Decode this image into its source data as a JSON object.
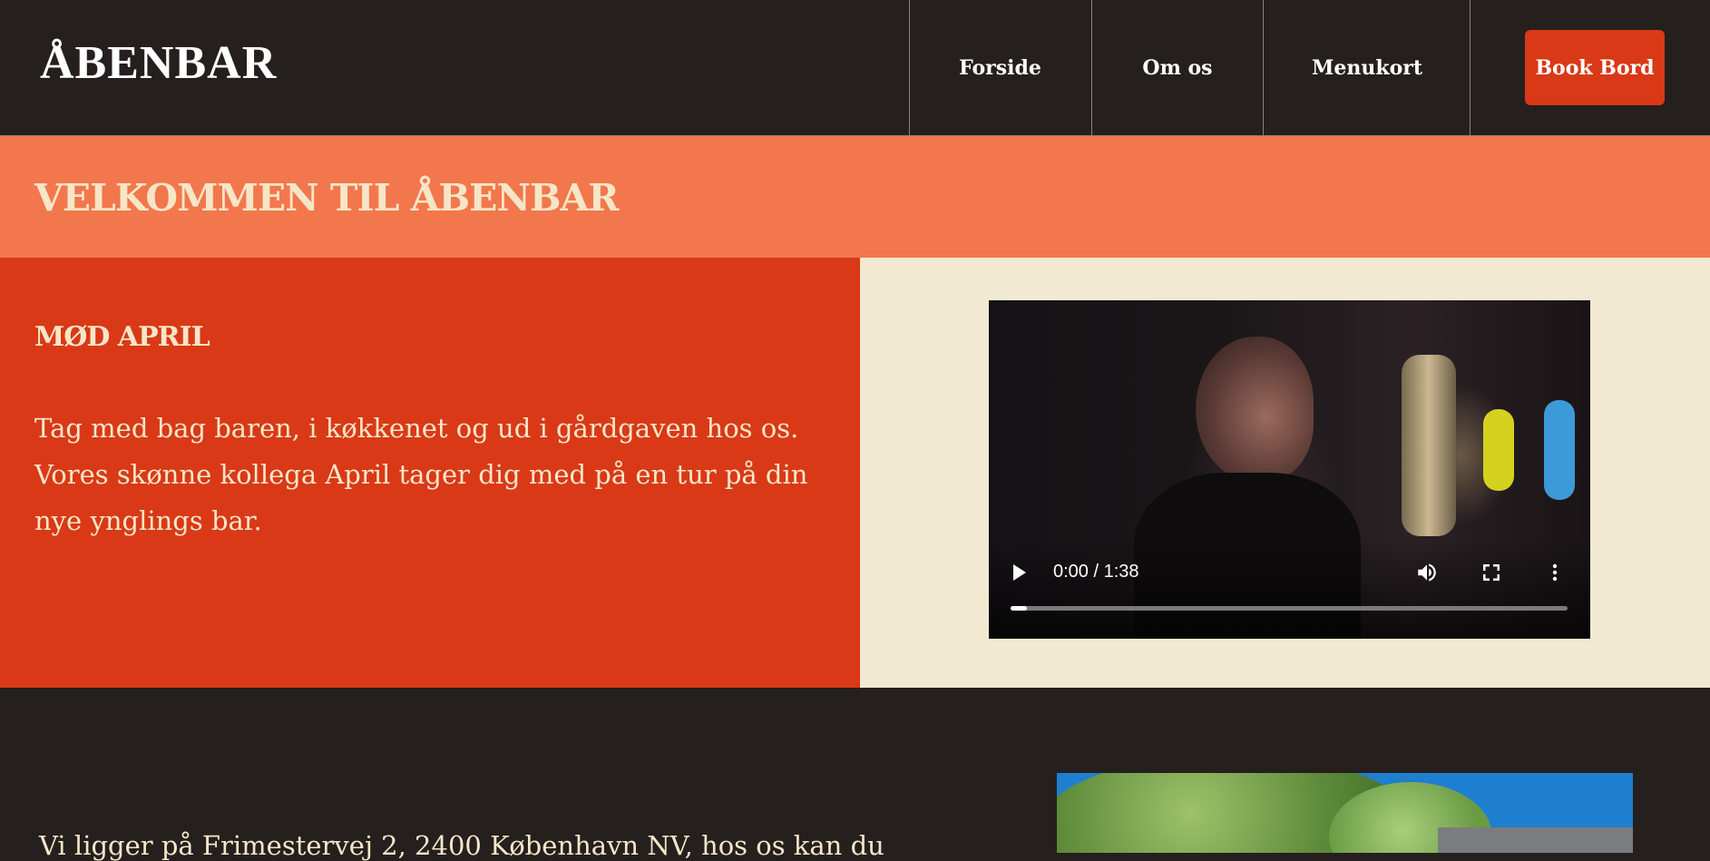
{
  "header": {
    "logo": "ÅBENBAR",
    "nav": {
      "home": "Forside",
      "about": "Om os",
      "menu": "Menukort"
    },
    "book_button": "Book Bord"
  },
  "welcome": {
    "title": "VELKOMMEN TIL ÅBENBAR"
  },
  "feature": {
    "heading": "MØD APRIL",
    "body": "Tag med bag baren, i køkkenet og ud i gårdgaven hos os. Vores skønne kollega April tager dig med på en tur på din nye ynglings bar."
  },
  "video": {
    "time": "0:00 / 1:38",
    "progress": 0.03,
    "icons": {
      "play": "play-icon",
      "volume": "volume-icon",
      "fullscreen": "fullscreen-icon",
      "more": "more-vert-icon"
    }
  },
  "location": {
    "text": "Vi ligger på Frimestervej 2, 2400 København NV, hos os kan du"
  },
  "colors": {
    "dark": "#251f1e",
    "accent_red": "#d93917",
    "accent_orange": "#f3774c",
    "cream": "#f6e6c8",
    "panel_cream": "#f1e9d2"
  }
}
